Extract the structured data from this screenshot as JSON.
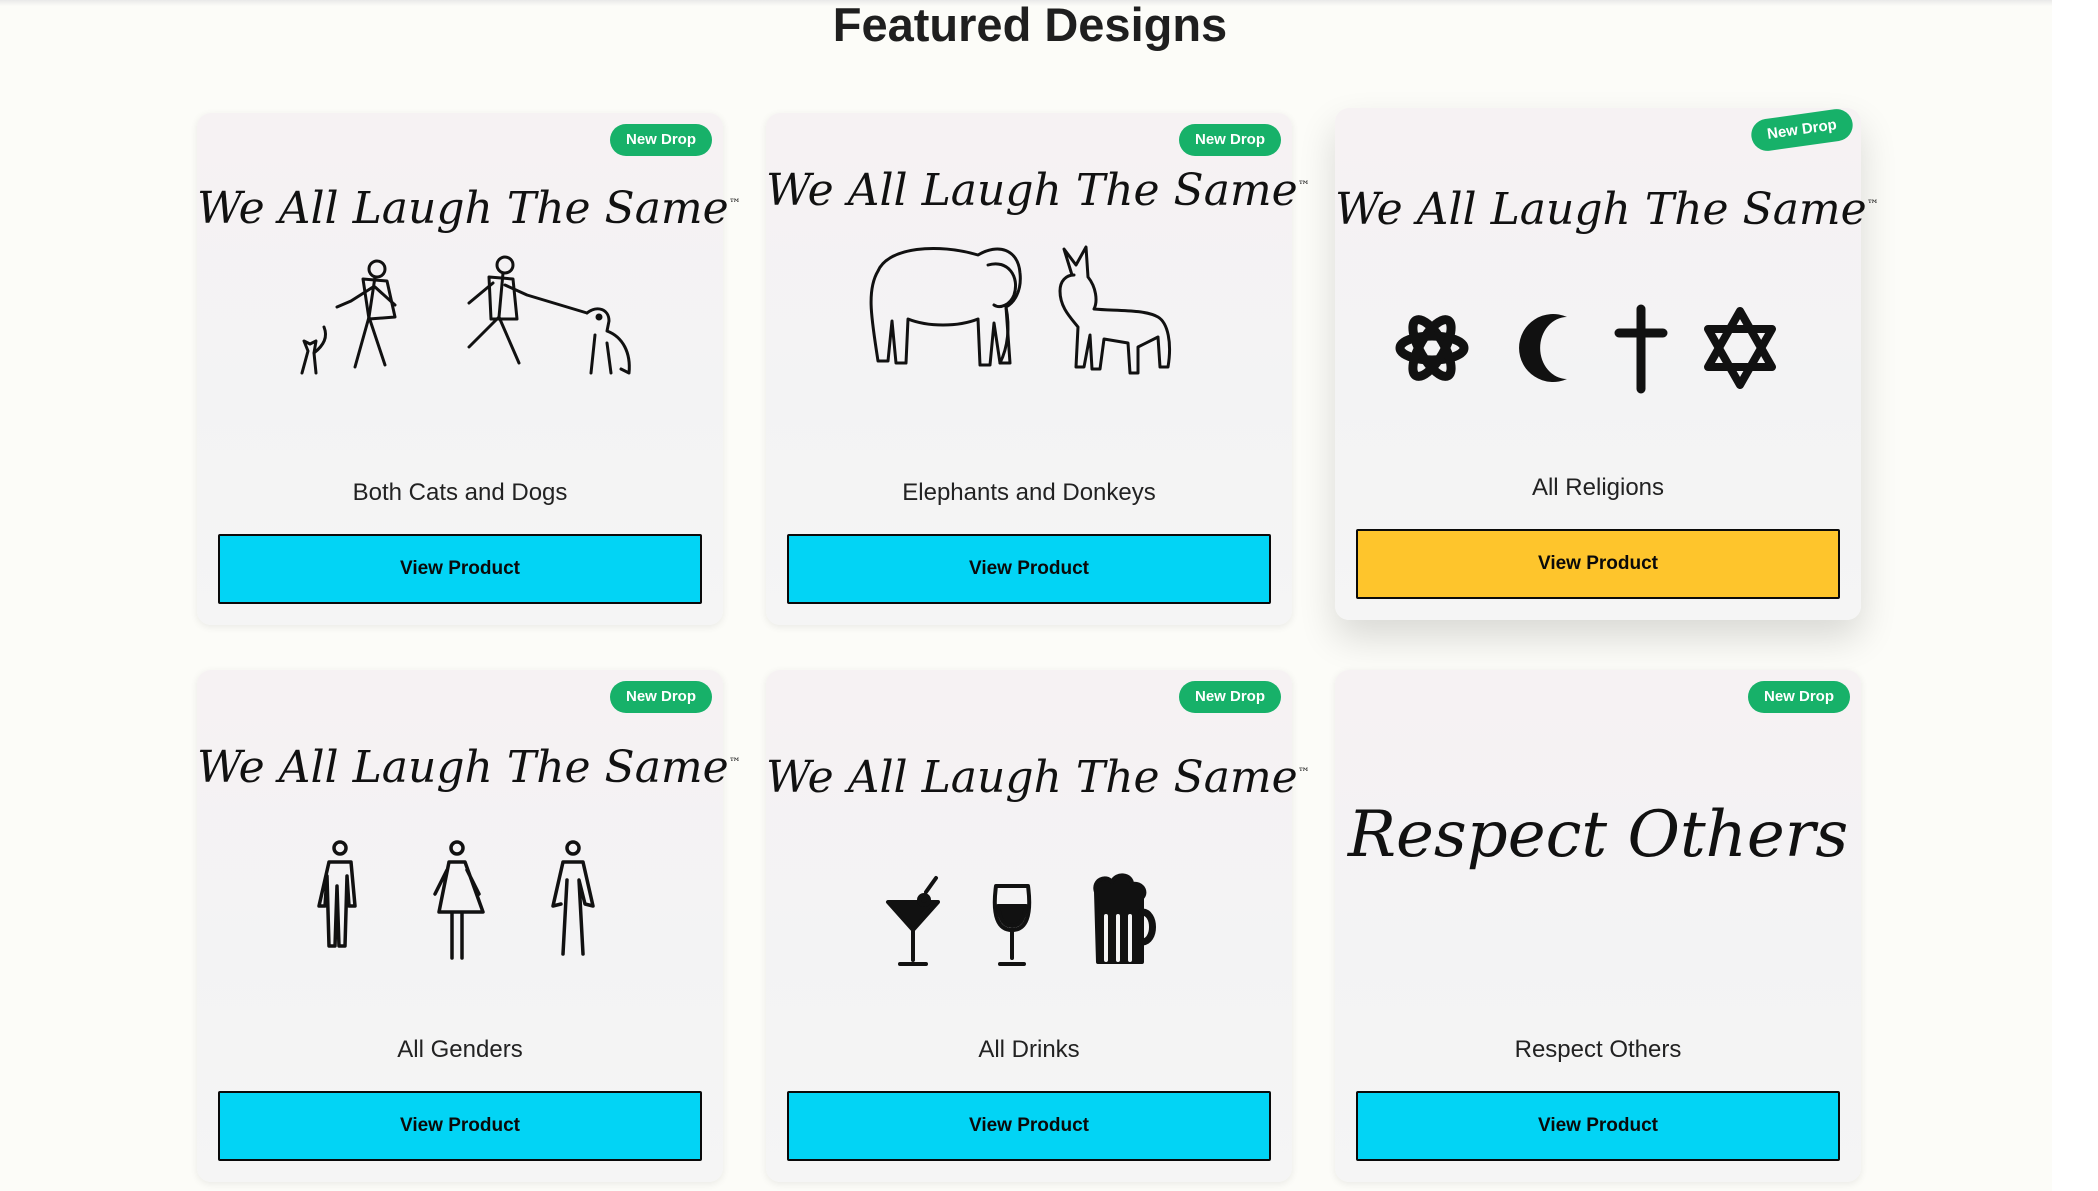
{
  "page": {
    "title": "Featured Designs"
  },
  "colors": {
    "accent_button": "#02d4f5",
    "hover_button": "#fec52c",
    "badge": "#17b169"
  },
  "cards": [
    {
      "badge": "New Drop",
      "slogan": "We All Laugh The Same",
      "tm": "™",
      "caption": "Both Cats and Dogs",
      "button": "View Product",
      "art": "cat-dog-walkers-icon"
    },
    {
      "badge": "New Drop",
      "slogan": "We All Laugh The Same",
      "tm": "™",
      "caption": "Elephants and Donkeys",
      "button": "View Product",
      "art": "elephant-donkey-icon"
    },
    {
      "badge": "New Drop",
      "slogan": "We All Laugh The Same",
      "tm": "™",
      "caption": "All Religions",
      "button": "View Product",
      "art": "religion-symbols-icon"
    },
    {
      "badge": "New Drop",
      "slogan": "We All Laugh The Same",
      "tm": "™",
      "caption": "All Genders",
      "button": "View Product",
      "art": "gender-figures-icon"
    },
    {
      "badge": "New Drop",
      "slogan": "We All Laugh The Same",
      "tm": "™",
      "caption": "All Drinks",
      "button": "View Product",
      "art": "drinks-icon"
    },
    {
      "badge": "New Drop",
      "slogan": "Respect Others",
      "tm": "",
      "caption": "Respect Others",
      "button": "View Product",
      "art": ""
    }
  ]
}
